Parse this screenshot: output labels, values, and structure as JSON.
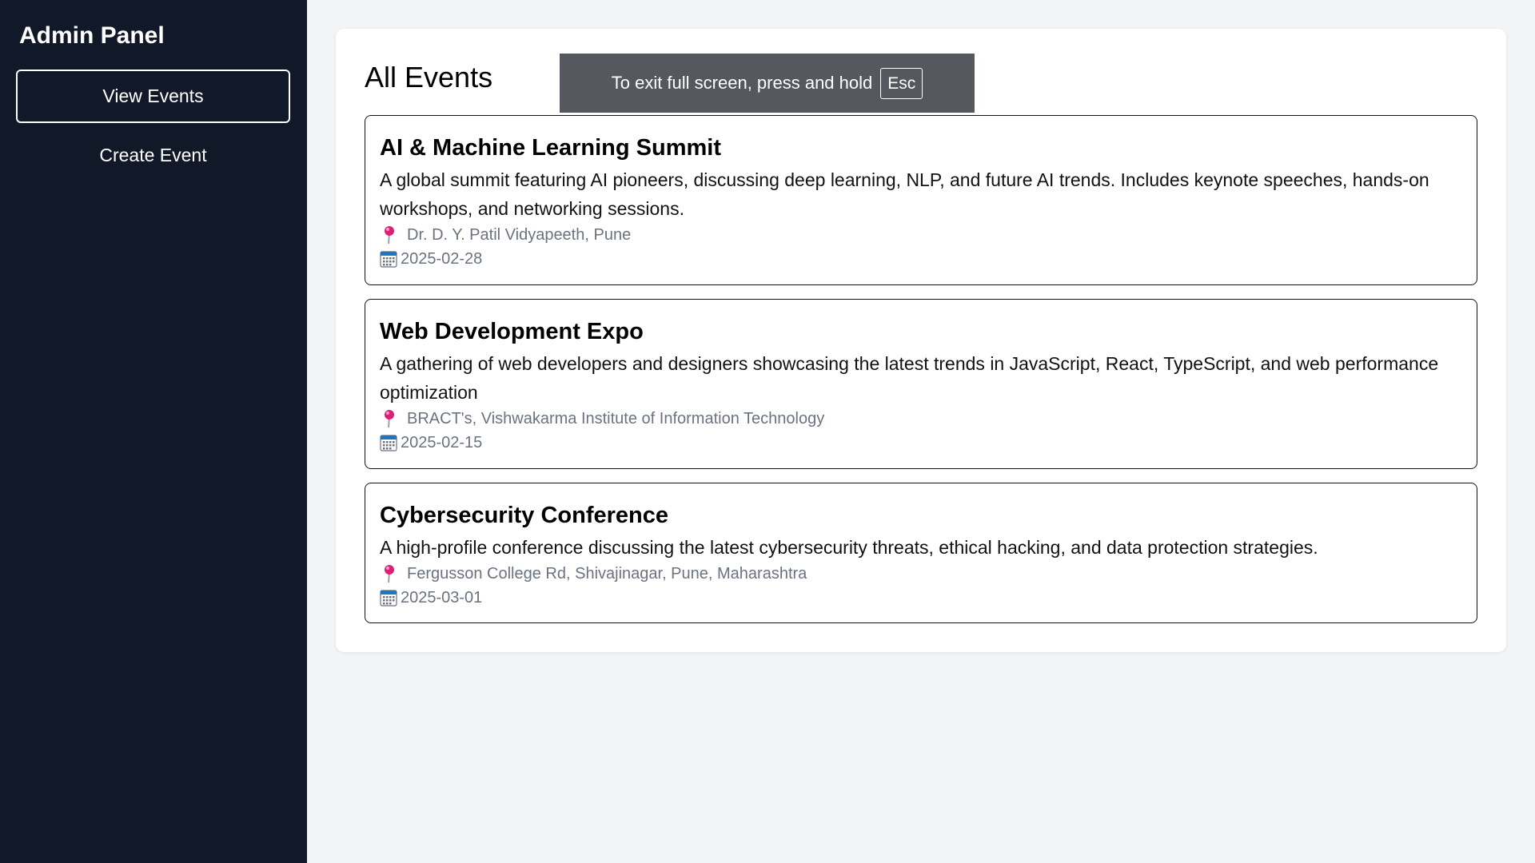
{
  "sidebar": {
    "title": "Admin Panel",
    "items": [
      {
        "label": "View Events",
        "active": true
      },
      {
        "label": "Create Event",
        "active": false
      }
    ],
    "background_color": "#111827"
  },
  "main": {
    "title": "All Events",
    "events": [
      {
        "title": "AI & Machine Learning Summit",
        "description": "A global summit featuring AI pioneers, discussing deep learning, NLP, and future AI trends. Includes keynote speeches, hands-on workshops, and networking sessions.",
        "location": "Dr. D. Y. Patil Vidyapeeth, Pune",
        "date": "2025-02-28"
      },
      {
        "title": "Web Development Expo",
        "description": "A gathering of web developers and designers showcasing the latest trends in JavaScript, React, TypeScript, and web performance optimization",
        "location": "BRACT's, Vishwakarma Institute of Information Technology",
        "date": "2025-02-15"
      },
      {
        "title": "Cybersecurity Conference",
        "description": "A high-profile conference discussing the latest cybersecurity threats, ethical hacking, and data protection strategies.",
        "location": "Fergusson College Rd, Shivajinagar, Pune, Maharashtra",
        "date": "2025-03-01"
      }
    ]
  },
  "fullscreen_toast": {
    "message": "To exit full screen, press and hold",
    "key": "Esc"
  },
  "icons": {
    "location": "pushpin-icon",
    "date": "calendar-icon"
  },
  "colors": {
    "page_background": "#f3f4f6",
    "card_background": "#ffffff",
    "pin": "#e11d74",
    "meta_text": "#6b7280"
  }
}
